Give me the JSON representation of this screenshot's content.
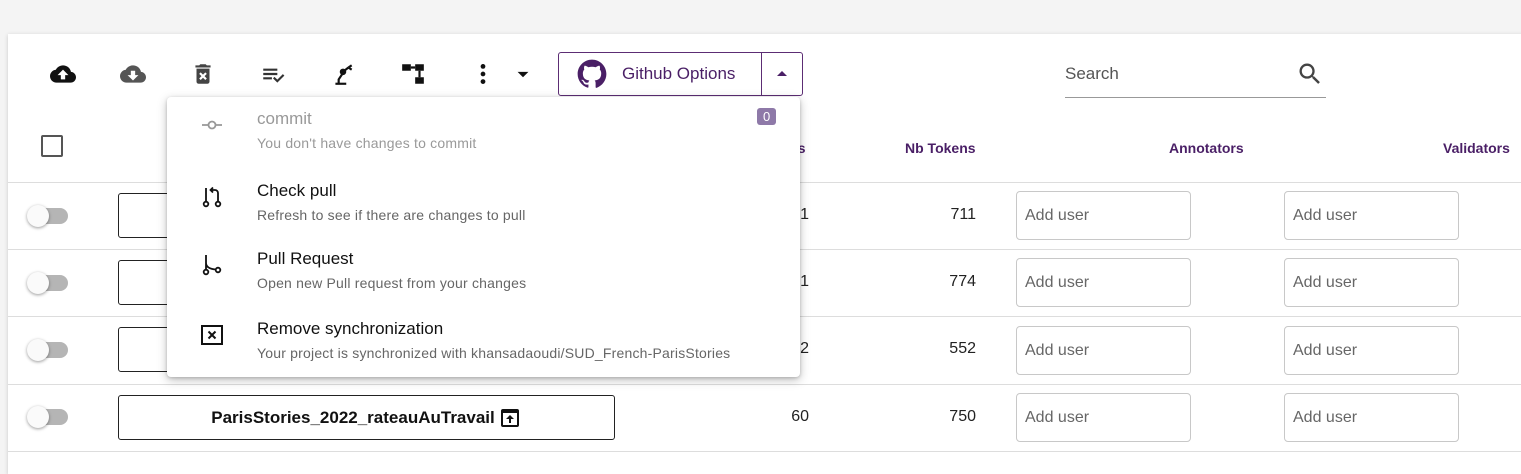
{
  "toolbar": {
    "icons": [
      "upload-cloud-icon",
      "download-cloud-icon",
      "delete-icon",
      "checklist-icon",
      "robot-arm-icon",
      "tree-structure-icon",
      "more-vertical-icon",
      "dropdown-arrow-icon"
    ],
    "github_label": "Github Options",
    "github_icon": "github-icon"
  },
  "search": {
    "placeholder": "Search"
  },
  "table": {
    "headers": {
      "sentences": "es",
      "tokens": "Nb Tokens",
      "annotators": "Annotators",
      "validators": "Validators"
    },
    "add_user_placeholder": "Add user",
    "rows": [
      {
        "name": "",
        "sentences": "1",
        "tokens": "711"
      },
      {
        "name": "",
        "sentences": "1",
        "tokens": "774"
      },
      {
        "name": "",
        "sentences": "2",
        "tokens": "552"
      },
      {
        "name": "ParisStories_2022_rateauAuTravail",
        "sentences": "60",
        "tokens": "750"
      }
    ]
  },
  "menu": {
    "items": [
      {
        "title": "commit",
        "subtitle": "You don't have changes to commit",
        "badge": "0",
        "icon": "commit-icon",
        "disabled": true
      },
      {
        "title": "Check pull",
        "subtitle": "Refresh to see if there are changes to pull",
        "icon": "pull-icon"
      },
      {
        "title": "Pull Request",
        "subtitle": "Open new Pull request from your changes",
        "icon": "pull-request-icon"
      },
      {
        "title": "Remove synchronization",
        "subtitle": "Your project is synchronized with khansadaoudi/SUD_French-ParisStories",
        "icon": "close-box-icon"
      }
    ]
  },
  "colors": {
    "accent": "#4a1f66",
    "badge": "#8e79a8"
  }
}
